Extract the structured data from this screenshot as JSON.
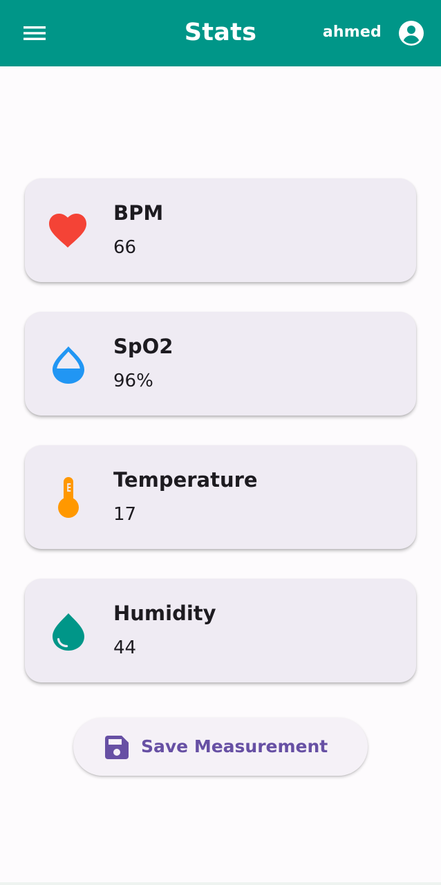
{
  "appbar": {
    "title": "Stats",
    "username": "ahmed",
    "background_color": "#009688",
    "menu_icon": "menu-icon",
    "account_icon": "account-circle-icon"
  },
  "stats": [
    {
      "label": "BPM",
      "value": "66",
      "icon": "heart-icon",
      "icon_color": "#f44336"
    },
    {
      "label": "SpO2",
      "value": "96%",
      "icon": "water-drop-half-icon",
      "icon_color": "#2196f3"
    },
    {
      "label": "Temperature",
      "value": "17",
      "icon": "thermometer-icon",
      "icon_color": "#ff9800"
    },
    {
      "label": "Humidity",
      "value": "44",
      "icon": "water-drop-icon",
      "icon_color": "#009688"
    }
  ],
  "save_button": {
    "label": "Save Measurement",
    "icon": "save-icon",
    "color": "#6750a4"
  }
}
